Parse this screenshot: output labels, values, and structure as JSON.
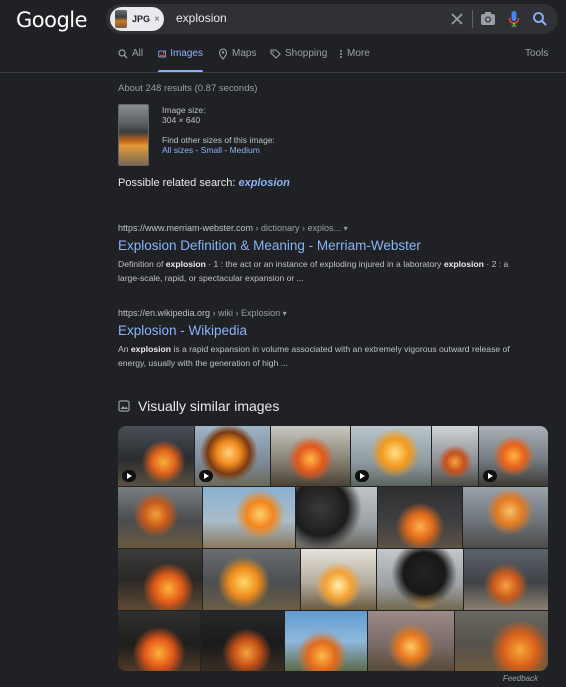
{
  "header": {
    "logo": "Google",
    "chip_label": "JPG",
    "chip_close": "×",
    "query": "explosion"
  },
  "tabs": [
    {
      "label": "All",
      "icon": "search-icon"
    },
    {
      "label": "Images",
      "icon": "image-icon",
      "active": true
    },
    {
      "label": "Maps",
      "icon": "map-pin-icon"
    },
    {
      "label": "Shopping",
      "icon": "tag-icon"
    },
    {
      "label": "More",
      "icon": "more-vert-icon"
    }
  ],
  "tools_label": "Tools",
  "stats": "About 248 results (0.87 seconds)",
  "image_info": {
    "size_label": "Image size:",
    "size_value": "304 × 640",
    "find_label": "Find other sizes of this image:",
    "all_sizes": "All sizes",
    "small": "Small",
    "medium": "Medium",
    "separator": " - "
  },
  "related": {
    "prefix": "Possible related search:",
    "term": "explosion"
  },
  "results": [
    {
      "url": "https://www.merriam-webster.com",
      "crumb": " › dictionary › explos...",
      "title": "Explosion Definition & Meaning - Merriam-Webster",
      "snippet_parts": [
        "Definition of ",
        "explosion",
        " · 1 : the act or an instance of exploding injured in a laboratory ",
        "explosion",
        " · 2 : a large-scale, rapid, or spectacular expansion or ..."
      ]
    },
    {
      "url": "https://en.wikipedia.org",
      "crumb": " › wiki › Explosion",
      "title": "Explosion - Wikipedia",
      "snippet_parts": [
        "An ",
        "explosion",
        " is a rapid expansion in volume associated with an extremely vigorous outward release of energy, usually with the generation of high ..."
      ]
    }
  ],
  "visually_similar_title": "Visually similar images",
  "feedback": "Feedback",
  "colors": {
    "bg": "#202124",
    "link": "#8ab4f8",
    "text": "#bdc1c6",
    "fire": "#f28c1c"
  }
}
